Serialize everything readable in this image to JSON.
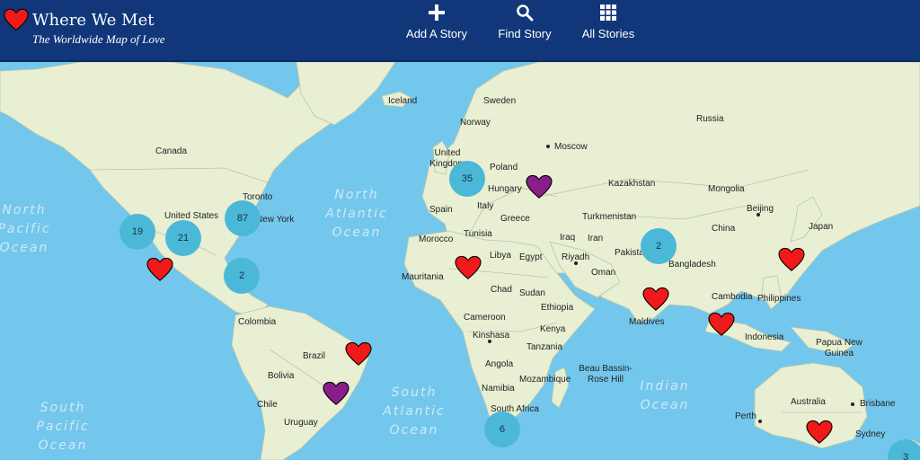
{
  "header": {
    "brand_title": "Where We Met",
    "brand_tagline": "The Worldwide Map of Love",
    "nav": [
      {
        "label": "Add A Story",
        "icon": "plus-icon"
      },
      {
        "label": "Find Story",
        "icon": "search-icon"
      },
      {
        "label": "All Stories",
        "icon": "grid-icon"
      }
    ]
  },
  "colors": {
    "header_bg": "#11377a",
    "ocean": "#74c7ec",
    "land": "#e8efd2",
    "cluster": "#4cb8d8",
    "heart_red": "#f01a1a",
    "heart_purple": "#8a1d8a"
  },
  "map": {
    "country_labels": [
      "Iceland",
      "Sweden",
      "Norway",
      "Russia",
      "United Kingdom",
      "Moscow",
      "Poland",
      "Hungary",
      "Kazakhstan",
      "Mongolia",
      "Canada",
      "Toronto",
      "United States",
      "New York",
      "Spain",
      "Italy",
      "Greece",
      "Turkmenistan",
      "Beijing",
      "Japan",
      "Morocco",
      "Tunisia",
      "Iraq",
      "Iran",
      "China",
      "Libya",
      "Egypt",
      "Riyadh",
      "Pakistan",
      "Bangladesh",
      "Mauritania",
      "Oman",
      "Chad",
      "Sudan",
      "Cambodia",
      "Philippines",
      "Maldives",
      "Colombia",
      "Ethiopia",
      "Cameroon",
      "Indonesia",
      "Kinshasa",
      "Kenya",
      "Tanzania",
      "Papua New Guinea",
      "Brazil",
      "Angola",
      "Beau Bassin-Rose Hill",
      "Bolivia",
      "Namibia",
      "Mozambique",
      "Australia",
      "Brisbane",
      "Chile",
      "South Africa",
      "Perth",
      "Sydney",
      "Uruguay"
    ],
    "ocean_labels": [
      "North Atlantic Ocean",
      "South Atlantic Ocean",
      "Indian Ocean",
      "North Pacific Ocean",
      "South Pacific Ocean"
    ],
    "clusters": [
      "19",
      "21",
      "87",
      "2",
      "35",
      "2",
      "6",
      "3"
    ],
    "hearts": [
      "red",
      "red",
      "red",
      "red",
      "red",
      "red",
      "red",
      "red",
      "purple",
      "purple"
    ]
  }
}
